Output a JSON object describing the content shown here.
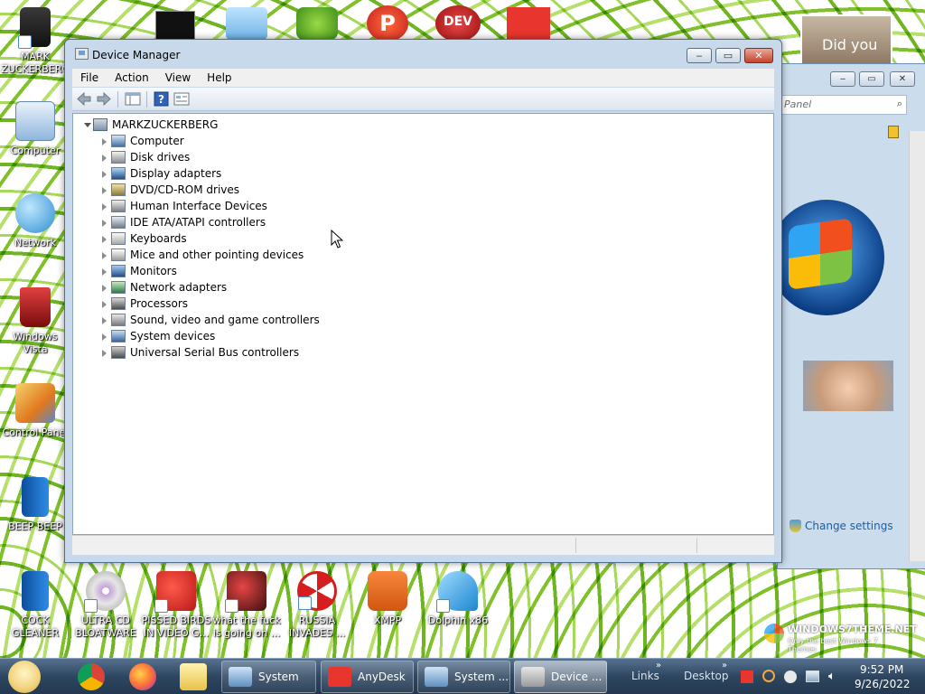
{
  "desktop": {
    "left_icons": [
      {
        "label": "MARK ZUCKERBERG"
      },
      {
        "label": "Computer"
      },
      {
        "label": "Network"
      },
      {
        "label": "Windows Vista"
      },
      {
        "label": "Control Panel"
      },
      {
        "label": "BEEP BEEP"
      }
    ],
    "bottom_icons": [
      {
        "label": "COCK GLEANER"
      },
      {
        "label": "ULTRA CD BLOATWARE"
      },
      {
        "label": "PISSED BIRDS IN VIDEO G..."
      },
      {
        "label": "what the fuck is going on ..."
      },
      {
        "label": "RUSSIA INVADES ..."
      },
      {
        "label": "XMPP"
      },
      {
        "label": "Dolphin x86"
      }
    ],
    "top_icons": [
      {
        "label": "DEV C++"
      }
    ],
    "watermark": {
      "line1": "WINDOWS7THEME.NET",
      "line2": "Only the best Windows 7 Themes"
    },
    "user_tile_text": "Did you"
  },
  "background_window": {
    "search_placeholder": "Panel",
    "change_settings": "Change settings"
  },
  "device_manager": {
    "title": "Device Manager",
    "menu": [
      "File",
      "Action",
      "View",
      "Help"
    ],
    "root": "MARKZUCKERBERG",
    "categories": [
      "Computer",
      "Disk drives",
      "Display adapters",
      "DVD/CD-ROM drives",
      "Human Interface Devices",
      "IDE ATA/ATAPI controllers",
      "Keyboards",
      "Mice and other pointing devices",
      "Monitors",
      "Network adapters",
      "Processors",
      "Sound, video and game controllers",
      "System devices",
      "Universal Serial Bus controllers"
    ]
  },
  "taskbar": {
    "items": [
      {
        "label": "System",
        "icon": "system-icon"
      },
      {
        "label": "AnyDesk",
        "icon": "anydesk-icon"
      },
      {
        "label": "System ...",
        "icon": "system-icon"
      },
      {
        "label": "Device ...",
        "icon": "device-manager-icon"
      }
    ],
    "toolbars": [
      "Links",
      "Desktop"
    ],
    "time": "9:52 PM",
    "date": "9/26/2022"
  }
}
